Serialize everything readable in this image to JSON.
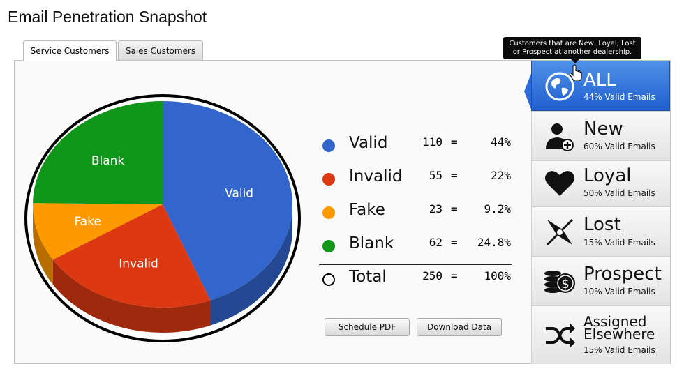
{
  "page": {
    "title": "Email Penetration Snapshot"
  },
  "tabs": [
    {
      "label": "Service Customers",
      "active": true
    },
    {
      "label": "Sales Customers",
      "active": false
    }
  ],
  "chart_data": {
    "type": "pie",
    "title": "",
    "categories": [
      "Valid",
      "Invalid",
      "Fake",
      "Blank"
    ],
    "values": [
      110,
      55,
      23,
      62
    ],
    "colors": [
      "#3366cc",
      "#dc3912",
      "#ff9900",
      "#109618"
    ]
  },
  "legend": {
    "rows": [
      {
        "label": "Valid",
        "count": "110",
        "eq": "=",
        "pct": "44%",
        "color": "#3366cc"
      },
      {
        "label": "Invalid",
        "count": "55",
        "eq": "=",
        "pct": "22%",
        "color": "#dc3912"
      },
      {
        "label": "Fake",
        "count": "23",
        "eq": "=",
        "pct": "9.2%",
        "color": "#ff9900"
      },
      {
        "label": "Blank",
        "count": "62",
        "eq": "=",
        "pct": "24.8%",
        "color": "#109618"
      }
    ],
    "total": {
      "label": "Total",
      "count": "250",
      "eq": "=",
      "pct": "100%"
    }
  },
  "buttons": {
    "schedule_pdf": "Schedule PDF",
    "download_data": "Download Data"
  },
  "segments": [
    {
      "title": "ALL",
      "subtitle": "44% Valid Emails",
      "icon": "globe-icon",
      "selected": true
    },
    {
      "title": "New",
      "subtitle": "60% Valid Emails",
      "icon": "add-user-icon"
    },
    {
      "title": "Loyal",
      "subtitle": "50% Valid Emails",
      "icon": "heart-icon"
    },
    {
      "title": "Lost",
      "subtitle": "15% Valid Emails",
      "icon": "compass-icon"
    },
    {
      "title": "Prospect",
      "subtitle": "10% Valid Emails",
      "icon": "coins-icon"
    },
    {
      "title_line1": "Assigned",
      "title_line2": "Elsewhere",
      "subtitle": "15% Valid Emails",
      "icon": "shuffle-icon"
    }
  ],
  "tooltip": {
    "line1": "Customers that are New, Loyal, Lost",
    "line2": "or Prospect at another dealership."
  }
}
